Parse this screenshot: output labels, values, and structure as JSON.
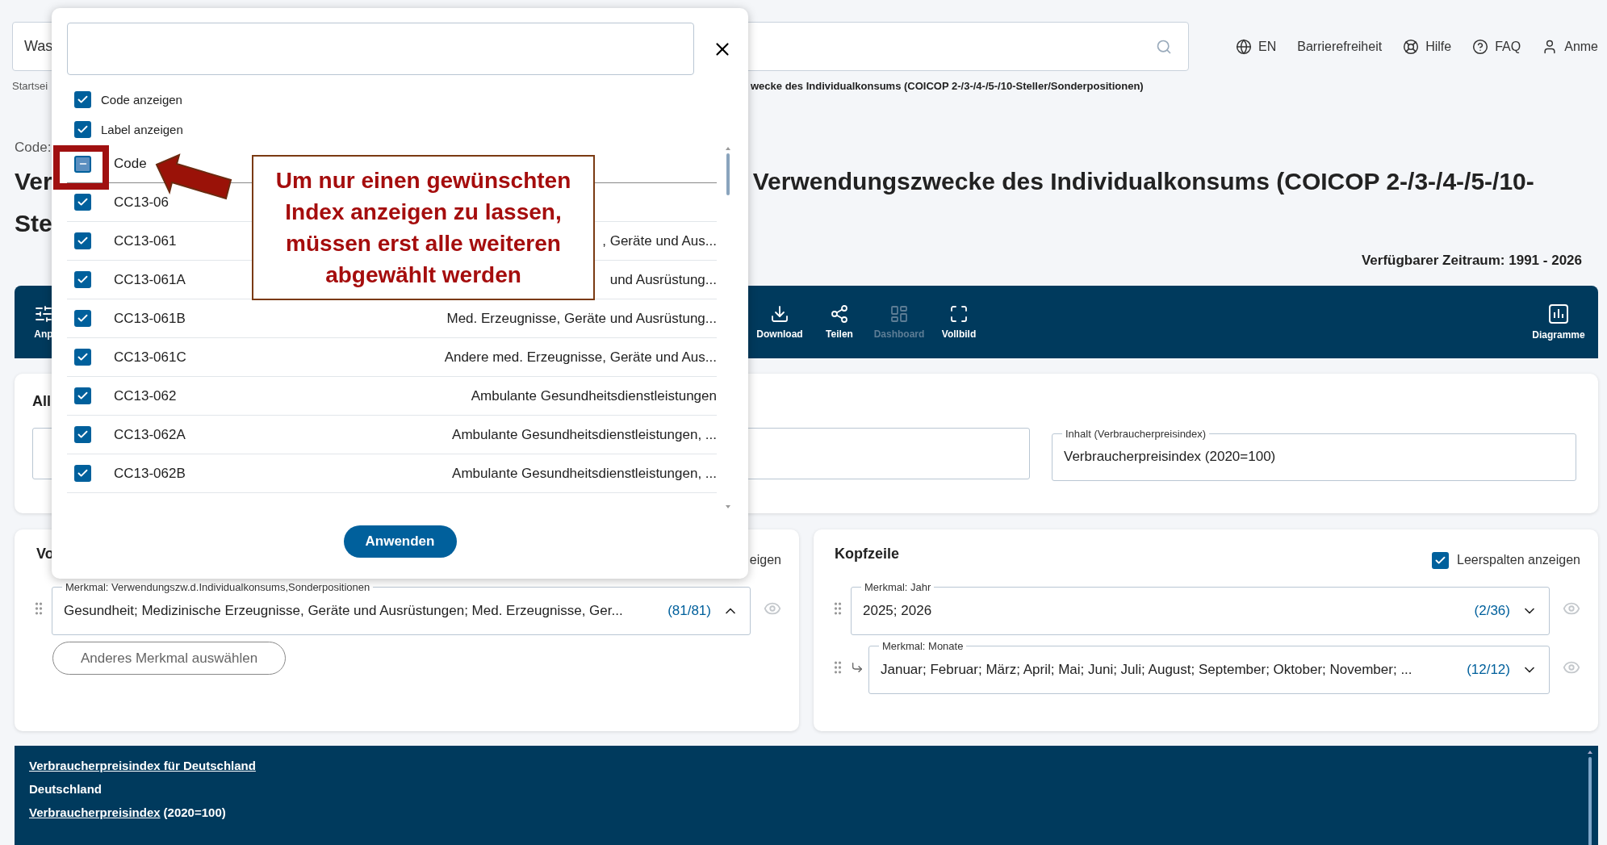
{
  "header": {
    "search": {
      "value": "Was"
    },
    "links": [
      {
        "kind": "globe",
        "label": "EN"
      },
      {
        "kind": "text",
        "label": "Barrierefreiheit"
      },
      {
        "kind": "lifebuoy",
        "label": "Hilfe"
      },
      {
        "kind": "help",
        "label": "FAQ"
      },
      {
        "kind": "user",
        "label": "Anme"
      }
    ]
  },
  "breadcrumb": {
    "start": "Startsei",
    "end": "wecke des Individualkonsums (COICOP 2-/3-/4-/5-/10-Steller/Sonderpositionen)"
  },
  "title": {
    "code_label": "Code:",
    "line1_start": "Ver",
    "line1_end": "Verwendungszwecke des Individualkonsums (COICOP 2-/3-/4-/5-/10-",
    "line2_start": "Ste"
  },
  "period": "Verfügbarer Zeitraum: 1991 - 2026",
  "toolbar": {
    "left": [
      {
        "kind": "sliders",
        "label": "Anp",
        "disabled": false
      }
    ],
    "items": [
      {
        "kind": "download",
        "label": "Download",
        "disabled": false
      },
      {
        "kind": "share",
        "label": "Teilen",
        "disabled": false
      },
      {
        "kind": "dashboard",
        "label": "Dashboard",
        "disabled": true
      },
      {
        "kind": "fullscreen",
        "label": "Vollbild",
        "disabled": false
      }
    ],
    "right": [
      {
        "kind": "chart",
        "label": "Diagramme",
        "disabled": false
      }
    ]
  },
  "content_card": {
    "heading": "All",
    "field": {
      "label": "Inhalt (Verbraucherpreisindex)",
      "value": "Verbraucherpreisindex (2020=100)"
    }
  },
  "rows_card": {
    "heading": "Vo",
    "option_label": "eigen",
    "button": "Anderes Merkmal auswählen",
    "fields": [
      {
        "label": "Merkmal: Verwendungszw.d.Individualkonsums,Sonderpositionen",
        "value": "Gesundheit; Medizinische Erzeugnisse, Geräte und Ausrüstungen; Med. Erzeugnisse, Ger...",
        "count": "(81/81)",
        "expanded": true,
        "nested": false
      }
    ]
  },
  "header_card": {
    "heading": "Kopfzeile",
    "option": {
      "label": "Leerspalten anzeigen",
      "checked": true
    },
    "fields": [
      {
        "label": "Merkmal: Jahr",
        "value": "2025; 2026",
        "count": "(2/36)",
        "expanded": false,
        "nested": false
      },
      {
        "label": "Merkmal: Monate",
        "value": "Januar; Februar; März; April; Mai; Juni; Juli; August; September; Oktober; November; ...",
        "count": "(12/12)",
        "expanded": false,
        "nested": true
      }
    ]
  },
  "footer": {
    "lines": [
      {
        "kind": "link",
        "text": "Verbraucherpreisindex für Deutschland"
      },
      {
        "kind": "bold",
        "text": "Deutschland"
      },
      {
        "kind": "link_suffix",
        "text": "Verbraucherpreisindex",
        "suffix": "(2020=100)"
      }
    ]
  },
  "dialog": {
    "options": [
      {
        "label": "Code anzeigen",
        "checked": true
      },
      {
        "label": "Label anzeigen",
        "checked": true
      }
    ],
    "list_header": {
      "label": "Code",
      "indeterminate": true
    },
    "rows": [
      {
        "code": "CC13-06",
        "checked": true
      },
      {
        "code": "CC13-061",
        "label": ", Geräte und Aus...",
        "checked": true
      },
      {
        "code": "CC13-061A",
        "label": "und Ausrüstung...",
        "checked": true
      },
      {
        "code": "CC13-061B",
        "label": "Med. Erzeugnisse, Geräte und Ausrüstung...",
        "checked": true
      },
      {
        "code": "CC13-061C",
        "label": "Andere med. Erzeugnisse, Geräte und Aus...",
        "checked": true
      },
      {
        "code": "CC13-062",
        "label": "Ambulante Gesundheitsdienstleistungen",
        "checked": true
      },
      {
        "code": "CC13-062A",
        "label": "Ambulante Gesundheitsdienstleistungen, ...",
        "checked": true
      },
      {
        "code": "CC13-062B",
        "label": "Ambulante Gesundheitsdienstleistungen, ...",
        "checked": true
      }
    ],
    "button": "Anwenden"
  },
  "callout": {
    "text": "Um nur einen gewünschten Index anzeigen zu lassen, müssen erst alle weiteren abgewählt werden"
  }
}
